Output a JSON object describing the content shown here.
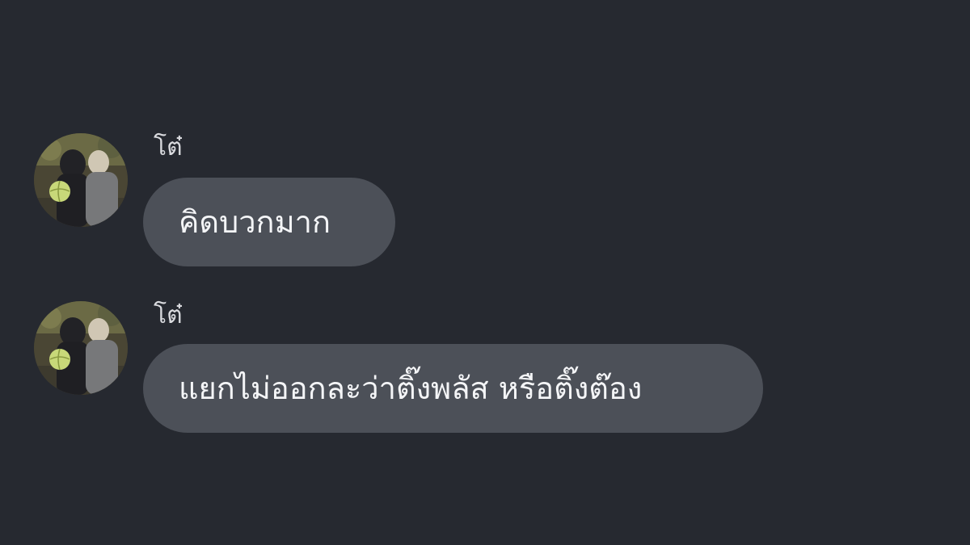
{
  "messages": [
    {
      "sender": "โต๋",
      "avatar_icon": "profile-photo",
      "text": "คิดบวกมาก"
    },
    {
      "sender": "โต๋",
      "avatar_icon": "profile-photo",
      "text": "แยกไม่ออกละว่าติ๊งพลัส หรือติ๊งต๊อง"
    }
  ],
  "colors": {
    "background": "#262930",
    "bubble": "#4c5058",
    "text": "#f4f5f7",
    "sender": "#d9dade"
  }
}
